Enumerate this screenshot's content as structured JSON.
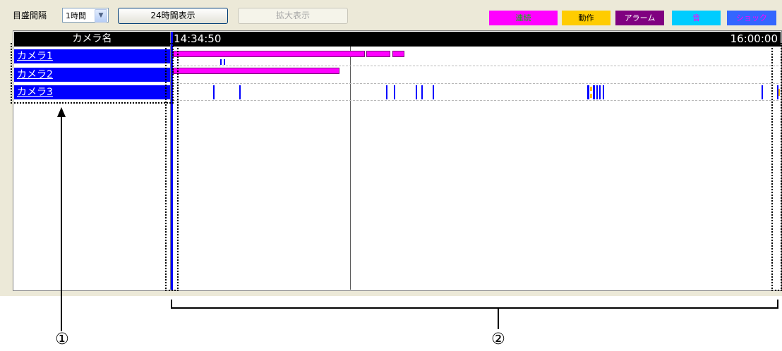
{
  "toolbar": {
    "scale_label": "目盛間隔",
    "scale_value": "1時間",
    "btn_24h": "24時間表示",
    "btn_zoom": "拡大表示"
  },
  "legend": [
    {
      "label": "連続",
      "bg": "#ff00ff",
      "fg": "#00c000"
    },
    {
      "label": "動作",
      "bg": "#ffcc00",
      "fg": "#000000"
    },
    {
      "label": "アラーム",
      "bg": "#800080",
      "fg": "#ffffff"
    },
    {
      "label": "音",
      "bg": "#00ccff",
      "fg": "#ff00ff"
    },
    {
      "label": "ショック",
      "bg": "#3366ff",
      "fg": "#ff00ff"
    }
  ],
  "timeline": {
    "camera_header": "カメラ名",
    "start_time": "14:34:50",
    "end_time": "16:00:00",
    "cameras": [
      "カメラ1",
      "カメラ2",
      "カメラ3"
    ]
  },
  "callouts": {
    "one": "①",
    "two": "②"
  },
  "colors": {
    "continuous": "#ff00ff",
    "camera_row": "#0000ff",
    "event_tick": "#0000ff",
    "motion_tick": "#ffbf00"
  }
}
